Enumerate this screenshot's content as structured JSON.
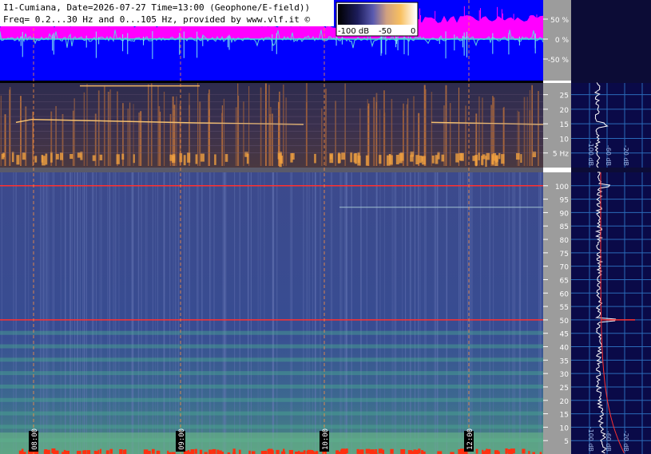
{
  "header": {
    "line1": "I1-Cumiana, Date=2026-07-27 Time=13:00 (Geophone/E-field))",
    "line2": "Freq= 0.2...30 Hz and 0...105 Hz, provided by www.vlf.it ©"
  },
  "colorbar": {
    "min_label": "-100 dB",
    "mid_label": "-50",
    "max_label": "0"
  },
  "waveform_axis": {
    "ticks": [
      {
        "value": 50,
        "label": "50 %"
      },
      {
        "value": 0,
        "label": "0 %"
      },
      {
        "value": -50,
        "label": "-50 %"
      }
    ]
  },
  "time_labels": [
    "08:00",
    "09:00",
    "10:00",
    "12:00"
  ],
  "low_axis": {
    "min": 0,
    "max": 29,
    "ticks": [
      {
        "value": 25,
        "label": "25"
      },
      {
        "value": 20,
        "label": "20"
      },
      {
        "value": 15,
        "label": "15"
      },
      {
        "value": 10,
        "label": "10"
      },
      {
        "value": 5,
        "label": "5 Hz"
      }
    ]
  },
  "high_axis": {
    "min": 0,
    "max": 105,
    "ticks": [
      100,
      95,
      90,
      85,
      80,
      75,
      70,
      65,
      60,
      55,
      50,
      45,
      40,
      35,
      30,
      25,
      20,
      15,
      10,
      5
    ]
  },
  "profile_labels": {
    "low": [
      "-100 dB",
      "-60 dB",
      "-20 dB"
    ],
    "high": [
      "-100 dB",
      "-60 dB",
      "-20 dB"
    ]
  },
  "chart_data": {
    "type": "heatmap",
    "title": "I1-Cumiana, Date=2026-07-27 Time=13:00 (Geophone/E-field))",
    "subtitle": "Freq= 0.2...30 Hz and 0...105 Hz, provided by www.vlf.it ©",
    "x": [
      "08:00",
      "09:00",
      "10:00",
      "12:00"
    ],
    "panels": [
      {
        "name": "",
        "ylim": [
          0.2,
          30
        ],
        "ylabel": "Hz"
      },
      {
        "name": "",
        "ylim": [
          0,
          105
        ],
        "ylabel": "Hz"
      }
    ],
    "lines_hz": [
      50,
      100
    ],
    "colorscale_db": [
      -100,
      0
    ],
    "waveform_percent": [
      -50,
      50
    ]
  },
  "colors": {
    "background": "#0c0c36",
    "waveform_bg": "#0000ff",
    "envelope": "#ff00ff",
    "spectrum_low": "#2a2a50",
    "spectrum_high": "#3a4a8a",
    "axis_grey": "#9c9c9c",
    "profile_bg": "#0a0a48",
    "line_red": "#ff2020"
  }
}
